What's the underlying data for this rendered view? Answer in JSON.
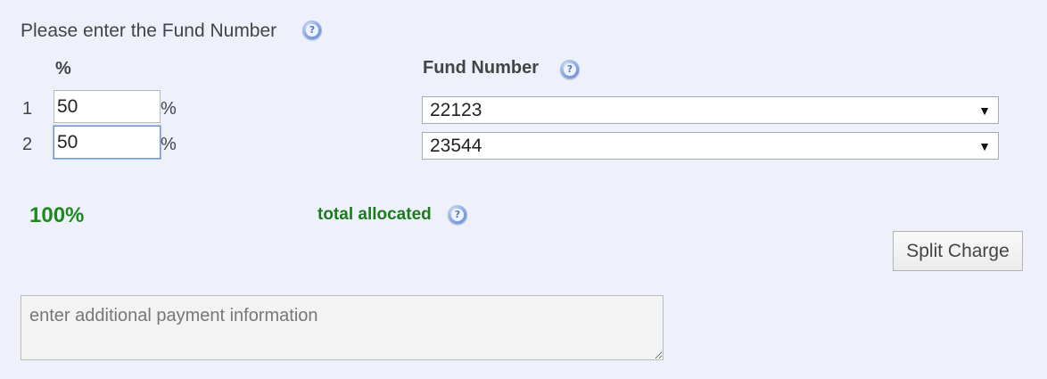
{
  "form": {
    "prompt": "Please enter the Fund Number",
    "percent_header": "%",
    "fund_header": "Fund Number",
    "percent_sign": "%",
    "rows": [
      {
        "index": "1",
        "percent": "50",
        "fund": "22123"
      },
      {
        "index": "2",
        "percent": "50",
        "fund": "23544"
      }
    ],
    "select_arrow": "▼",
    "help_glyph": "?"
  },
  "summary": {
    "total": "100%",
    "label": "total allocated"
  },
  "actions": {
    "split_label": "Split Charge"
  },
  "payment": {
    "placeholder": "enter additional payment information"
  },
  "colors": {
    "background": "#eef1fc",
    "total_green": "#1d8a1d",
    "focus_border": "#6c96d6"
  },
  "icons": {
    "help": "help-icon",
    "dropdown": "chevron-down-icon"
  }
}
